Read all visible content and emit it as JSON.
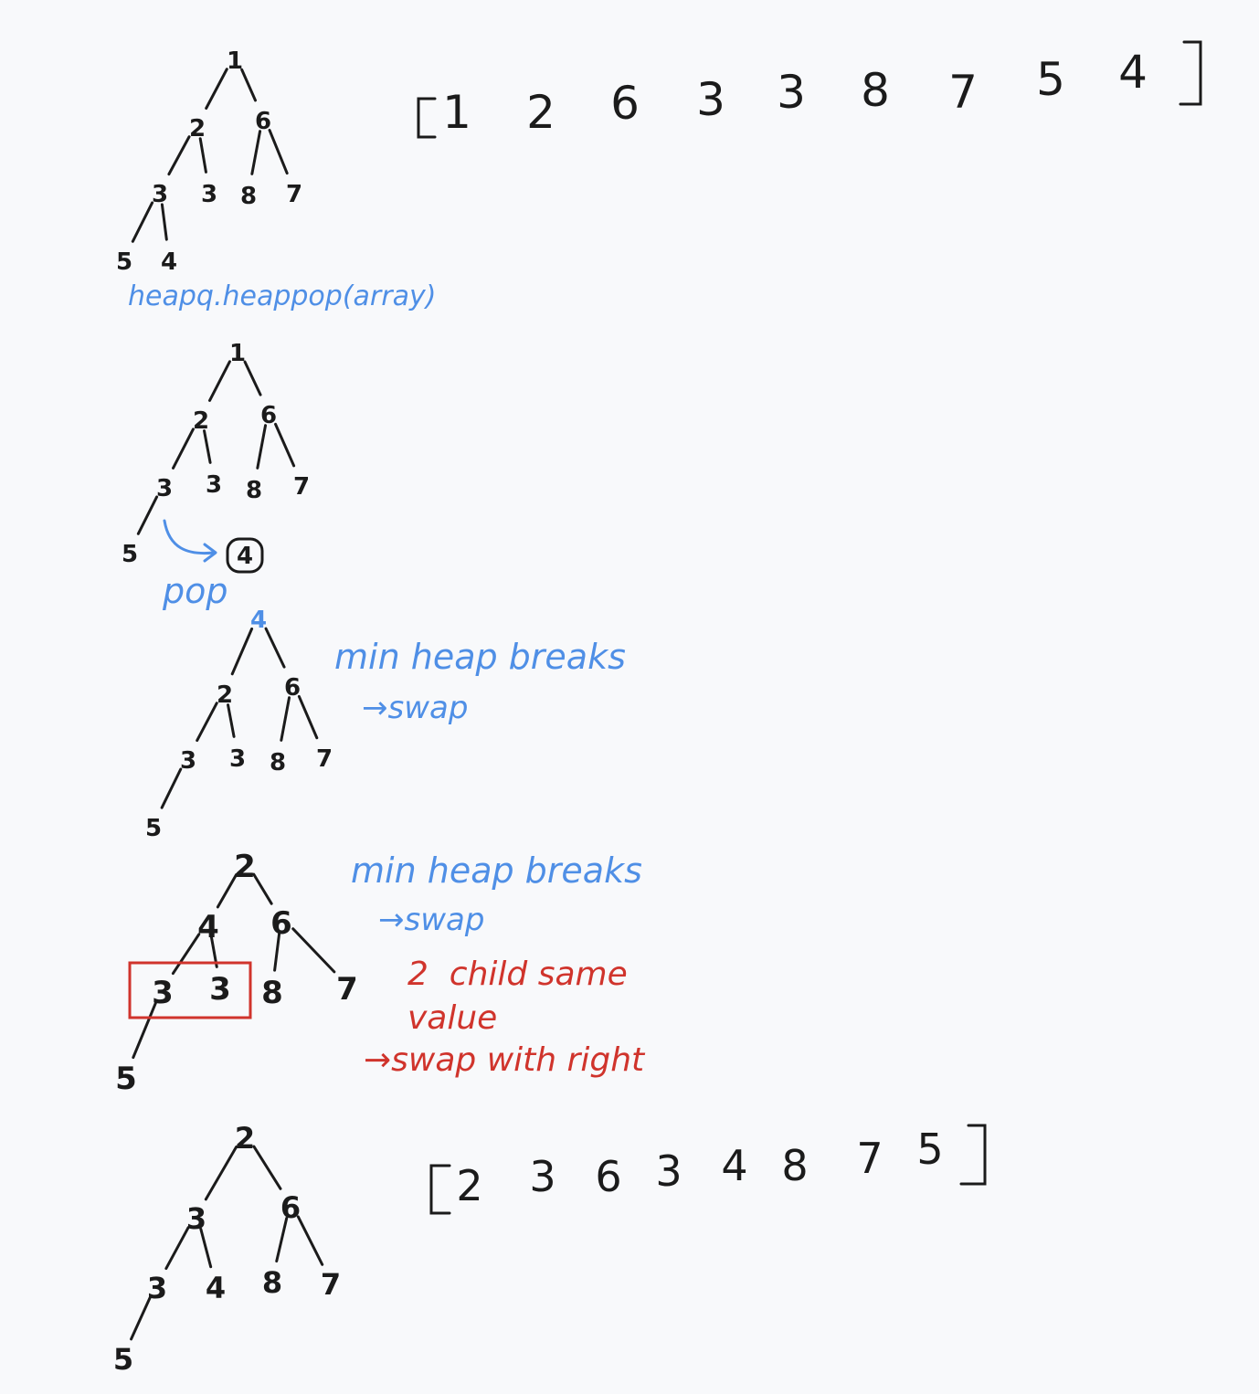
{
  "colors": {
    "ink": "#1b1b1b",
    "blue": "#4f8fe6",
    "red": "#d0342c",
    "background": "#f8f9fb"
  },
  "array_top": [
    "1",
    "2",
    "6",
    "3",
    "3",
    "8",
    "7",
    "5",
    "4"
  ],
  "array_bottom": [
    "2",
    "3",
    "6",
    "3",
    "4",
    "8",
    "7",
    "5"
  ],
  "trees": [
    {
      "values": [
        "1",
        "2",
        "6",
        "3",
        "3",
        "8",
        "7",
        "5",
        "4"
      ]
    },
    {
      "values": [
        "1",
        "2",
        "6",
        "3",
        "3",
        "8",
        "7",
        "5"
      ],
      "popped": "4"
    },
    {
      "values": [
        "4",
        "2",
        "6",
        "3",
        "3",
        "8",
        "7",
        "5"
      ]
    },
    {
      "values": [
        "2",
        "4",
        "6",
        "3",
        "3",
        "8",
        "7",
        "5"
      ]
    },
    {
      "values": [
        "2",
        "3",
        "6",
        "3",
        "4",
        "8",
        "7",
        "5"
      ]
    }
  ],
  "notes": {
    "heappop_call": "heapq.heappop(array)",
    "pop_label": "pop",
    "step3_line1": "min heap breaks",
    "step3_line2": "→swap",
    "step4_line1": "min heap breaks",
    "step4_line2": "→swap",
    "red_line1": "2  child same",
    "red_line2": "value",
    "red_line3": "→swap with right"
  }
}
